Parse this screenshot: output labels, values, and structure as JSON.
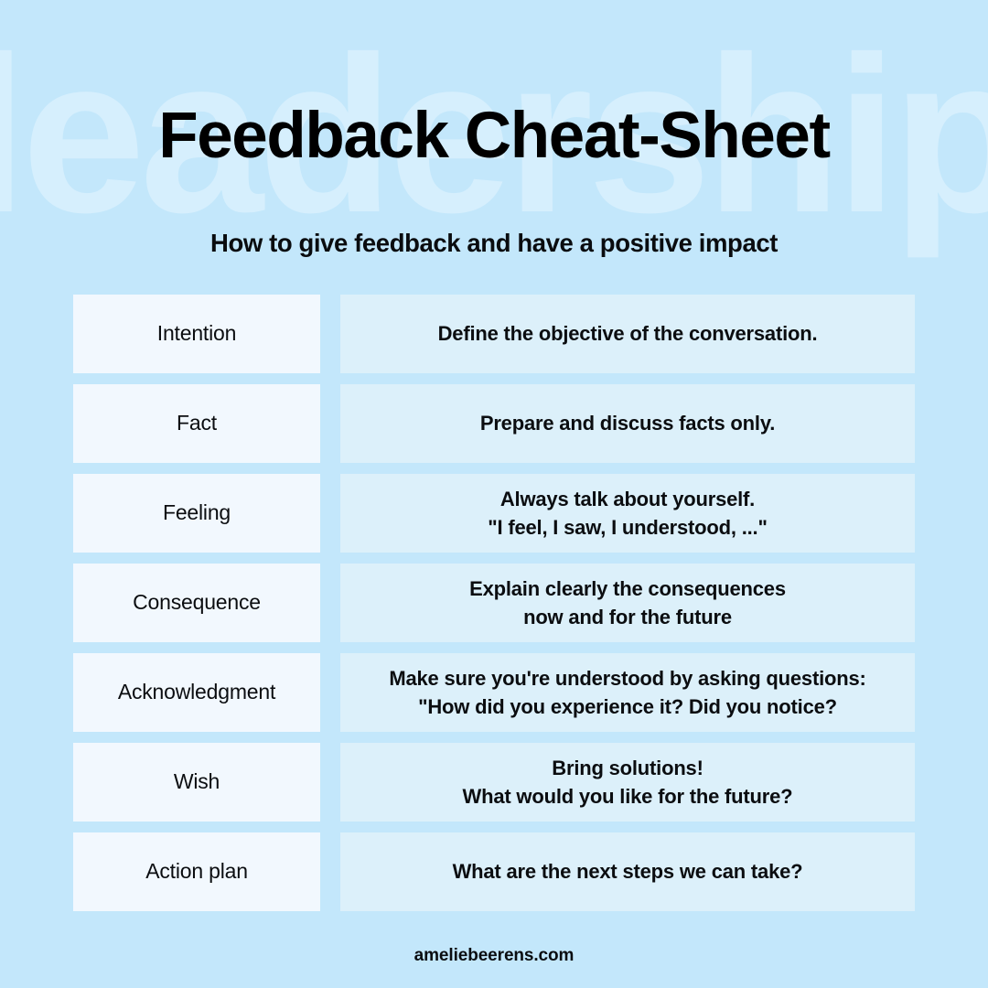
{
  "background": {
    "color": "#c3e7fb",
    "watermark_text": "leadership",
    "watermark_color": "#d6effd"
  },
  "header": {
    "title": "Feedback Cheat-Sheet",
    "subtitle": "How to give feedback and have a positive impact"
  },
  "palette": {
    "term_cell_bg": "#f2f8fe",
    "desc_cell_bg": "#dcf0fa",
    "text_color": "#0b0d10"
  },
  "table": {
    "rows": [
      {
        "term": "Intention",
        "description": "Define the objective of the conversation."
      },
      {
        "term": "Fact",
        "description": "Prepare and discuss facts only."
      },
      {
        "term": "Feeling",
        "description": "Always talk about yourself.\n\"I feel, I saw, I understood, ...\""
      },
      {
        "term": "Consequence",
        "description": "Explain clearly the consequences\nnow and for the future"
      },
      {
        "term": "Acknowledgment",
        "description": "Make sure you're understood by asking questions:\n\"How did you experience it? Did you notice?"
      },
      {
        "term": "Wish",
        "description": "Bring solutions!\nWhat would you like for the future?"
      },
      {
        "term": "Action plan",
        "description": "What are the next steps we can take?"
      }
    ]
  },
  "footer": {
    "website": "ameliebeerens.com"
  }
}
